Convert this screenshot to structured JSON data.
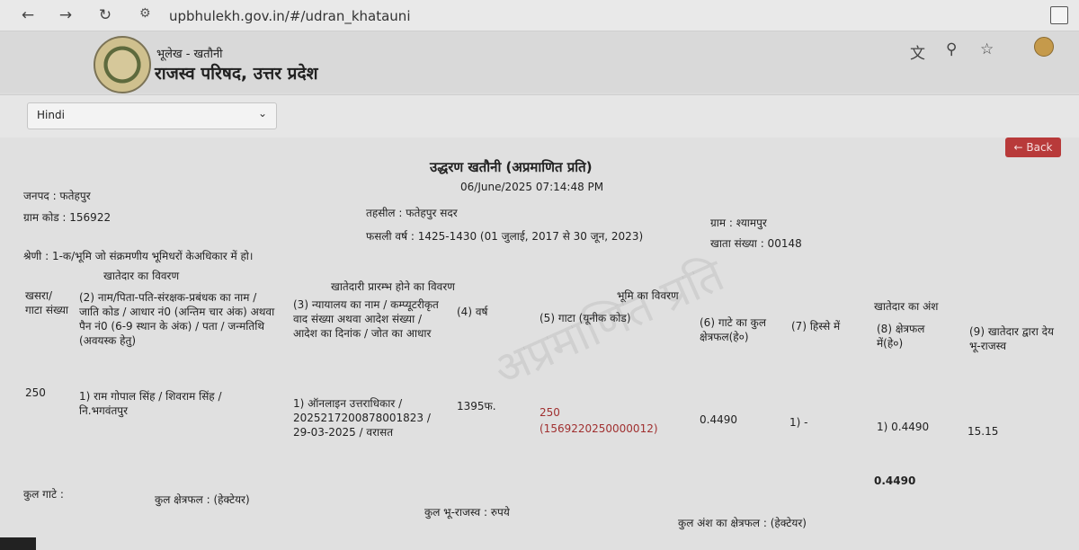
{
  "browser": {
    "back_icon": "←",
    "forward_icon": "→",
    "reload_icon": "↻",
    "site_info_icon": "⚙",
    "url": "upbhulekh.gov.in/#/udran_khatauni",
    "translate_icon": "文",
    "zoom_icon": "⚲",
    "bookmark_icon": "☆"
  },
  "header": {
    "title_small": "भूलेख - खतौनी",
    "title_big": "राजस्व परिषद, उत्तर प्रदेश"
  },
  "language": {
    "selected": "Hindi",
    "chevron": "⌄"
  },
  "back_button": {
    "label": "← Back"
  },
  "document": {
    "title": "उद्धरण खतौनी (अप्रमाणित प्रति)",
    "timestamp": "06/June/2025 07:14:48 PM",
    "watermark": "अप्रमाणित प्रति",
    "janpad": "जनपद : फतेहपुर",
    "gram_code": "ग्राम कोड : 156922",
    "tehsil": "तहसील : फतेहपुर सदर",
    "fasli_varsh": "फसली वर्ष : 1425-1430 (01 जुलाई, 2017 से 30 जून, 2023)",
    "gram": "ग्राम : श्यामपुर",
    "khata_sankhya": "खाता संख्या : 00148",
    "shreni": "श्रेणी : 1-क/भूमि जो संक्रमणीय भूमिधरों केअधिकार में हो।",
    "group_khatedar": "खातेदार का विवरण",
    "group_prarambh": "खातेदारी प्रारम्भ होने का विवरण",
    "group_bhumi": "भूमि का विवरण",
    "group_ansh": "खातेदार का अंश",
    "columns": {
      "c1": "खसरा/ गाटा संख्या",
      "c2": "(2) नाम/पिता-पति-संरक्षक-प्रबंधक का नाम / जाति कोड / आधार नं0 (अन्तिम चार अंक) अथवा पैन नं0 (6-9 स्थान के अंक) / पता / जन्मतिथि (अवयस्क हेतु)",
      "c3": "(3) न्यायालय का नाम / कम्प्यूटरीकृत वाद संख्या अथवा आदेश संख्या / आदेश का दिनांक / जोत का आधार",
      "c4": "(4) वर्ष",
      "c5": "(5) गाटा (यूनीक कोड)",
      "c6": "(6) गाटे का कुल क्षेत्रफल(हे०)",
      "c7": "(7) हिस्से में",
      "c8": "(8) क्षेत्रफल में(हे०)",
      "c9": "(9) खातेदार द्वारा देय भू-राजस्व"
    },
    "row": {
      "c1": "250",
      "c2": "1) राम गोपाल सिंह / शिवराम सिंह / नि.भगवंतपुर",
      "c3": "1) ऑनलाइन उत्तराधिकार / 2025217200878001823 / 29-03-2025 / वरासत",
      "c4": "1395फ.",
      "c5a": "250",
      "c5b": "(1569220250000012)",
      "c6": "0.4490",
      "c7": "1) -",
      "c8": "1) 0.4490",
      "c9": "15.15"
    },
    "total_area_value": "0.4490",
    "kul_gate": "कुल गाटे :",
    "kul_kshetrafal": "कुल क्षेत्रफल : (हेक्टेयर)",
    "kul_bhu_rajasv": "कुल भू-राजस्व : रुपये",
    "kul_ansh": "कुल अंश का क्षेत्रफल : (हेक्टेयर)"
  }
}
